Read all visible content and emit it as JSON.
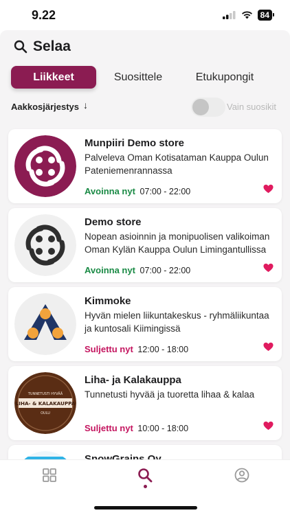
{
  "status_bar": {
    "time": "9.22",
    "battery": "84"
  },
  "header": {
    "title": "Selaa"
  },
  "tabs": [
    {
      "label": "Liikkeet",
      "active": true
    },
    {
      "label": "Suosittele",
      "active": false
    },
    {
      "label": "Etukupongit",
      "active": false
    }
  ],
  "sort": {
    "label": "Aakkosjärjestys",
    "favorites_label": "Vain suosikit",
    "favorites_only": false
  },
  "stores": [
    {
      "name": "Munpiiri Demo store",
      "description": "Palveleva Oman Kotisataman Kauppa Oulun Pateniemenrannassa",
      "status": "Avoinna nyt",
      "hours": "07:00 - 22:00",
      "open": true,
      "favorite": true,
      "logo": "munpiiri-logo-maroon"
    },
    {
      "name": "Demo store",
      "description": "Nopean asioinnin ja monipuolisen valikoiman Oman Kylän Kauppa Oulun Limingantullissa",
      "status": "Avoinna nyt",
      "hours": "07:00 - 22:00",
      "open": true,
      "favorite": true,
      "logo": "munpiiri-logo-dark"
    },
    {
      "name": "Kimmoke",
      "description": "Hyvän mielen liikuntakeskus - ryhmäliikuntaa ja kuntosali Kiimingissä",
      "status": "Suljettu nyt",
      "hours": "12:00 - 18:00",
      "open": false,
      "favorite": true,
      "logo": "kimmoke-logo"
    },
    {
      "name": "Liha- ja Kalakauppa",
      "description": "Tunnetusti hyvää ja tuoretta lihaa & kalaa",
      "status": "Suljettu nyt",
      "hours": "10:00 - 18:00",
      "open": false,
      "favorite": true,
      "logo": "liha-kala-logo",
      "logo_text": "LIHA- & KALAKAUPPA",
      "logo_subtext": "TUNNETUSTI HYVÄÄ",
      "logo_city": "OULU"
    },
    {
      "name": "SnowGrains Oy",
      "logo": "snowgrains-logo"
    }
  ],
  "colors": {
    "brand": "#8b1c52",
    "open": "#1a8a45",
    "closed": "#c4155f",
    "heart": "#e01b5f"
  },
  "bottom_nav": [
    {
      "icon": "grid-icon",
      "active": false
    },
    {
      "icon": "search-icon",
      "active": true
    },
    {
      "icon": "user-icon",
      "active": false
    }
  ]
}
